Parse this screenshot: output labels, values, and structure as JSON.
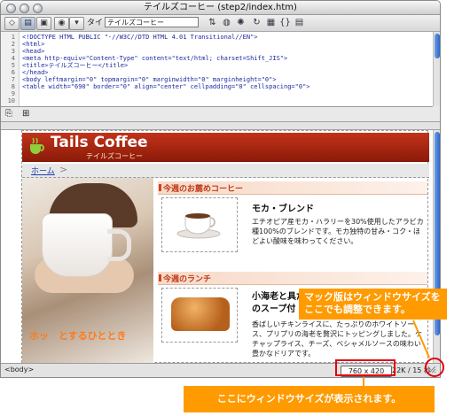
{
  "window": {
    "title": "テイルズコーヒー (step2/index.htm)"
  },
  "toolbar": {
    "title_label": "タイトル：",
    "title_value": "テイルズコーヒー"
  },
  "code_lines": [
    {
      "n": "1",
      "t": "<!DOCTYPE HTML PUBLIC \"-//W3C//DTD HTML 4.01 Transitional//EN\">"
    },
    {
      "n": "2",
      "t": "<html>"
    },
    {
      "n": "3",
      "t": "<head>"
    },
    {
      "n": "4",
      "t": "<meta http-equiv=\"Content-Type\" content=\"text/html; charset=Shift_JIS\">"
    },
    {
      "n": "5",
      "t": "<title>テイルズコーヒー</title>"
    },
    {
      "n": "6",
      "t": "</head>"
    },
    {
      "n": "7",
      "t": "<body leftmargin=\"0\" topmargin=\"0\" marginwidth=\"0\" marginheight=\"0\">"
    },
    {
      "n": "8",
      "t": "<table width=\"690\" border=\"0\" align=\"center\" cellpadding=\"0\" cellspacing=\"0\">"
    },
    {
      "n": "9",
      "t": ""
    },
    {
      "n": "10",
      "t": ""
    }
  ],
  "page": {
    "brand": "Tails Coffee",
    "brand_sub": "テイルズコーヒー",
    "crumb_home": "ホーム",
    "crumb_arrow": ">",
    "photo_caption": "ホッ　とするひととき",
    "section1_title": "今週のお薦めコーヒー",
    "item1_name": "モカ・ブレンド",
    "item1_desc": "エチオピア産モカ・ハラリーを30%使用したアラビカ種100%のブレンドです。モカ独特の甘み・コク・ほどよい酸味を味わってください。",
    "section2_title": "今週のランチ",
    "item2_name": "小海老と具だくさんのスープ付",
    "item2_desc": "香ばしいチキンライスに、たっぷりのホワイトソース、プリプリの海老を贅沢にトッピングしました。ケチャップライス、チーズ、ベシャメルソースの味わい豊かなドリアです。"
  },
  "status": {
    "tag": "<body>",
    "window_size": "760 x 420",
    "file_size": "22K / 15 秒"
  },
  "annotations": {
    "callout_resize": "マック版はウィンドウサイズをここでも調整できます。",
    "callout_size": "ここにウィンドウサイズが表示されます。"
  },
  "colors": {
    "accent_orange": "#ff9a00",
    "annotation_red": "#e2000f",
    "header_red": "#b22a12"
  }
}
